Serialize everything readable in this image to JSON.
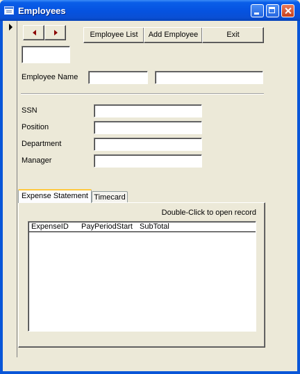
{
  "window": {
    "title": "Employees"
  },
  "nav": {
    "prev_icon": "arrow-left-icon",
    "next_icon": "arrow-right-icon"
  },
  "toolbar": {
    "employee_list_label": "Employee List",
    "add_employee_label": "Add Employee",
    "exit_label": "Exit"
  },
  "form": {
    "employee_name_label": "Employee Name",
    "ssn_label": "SSN",
    "position_label": "Position",
    "department_label": "Department",
    "manager_label": "Manager"
  },
  "tabs": [
    {
      "label": "Expense Statement",
      "active": true
    },
    {
      "label": "Timecard",
      "active": false
    }
  ],
  "expense_panel": {
    "hint": "Double-Click to open record",
    "columns": [
      "ExpenseID",
      "PayPeriodStart",
      "SubTotal"
    ]
  }
}
